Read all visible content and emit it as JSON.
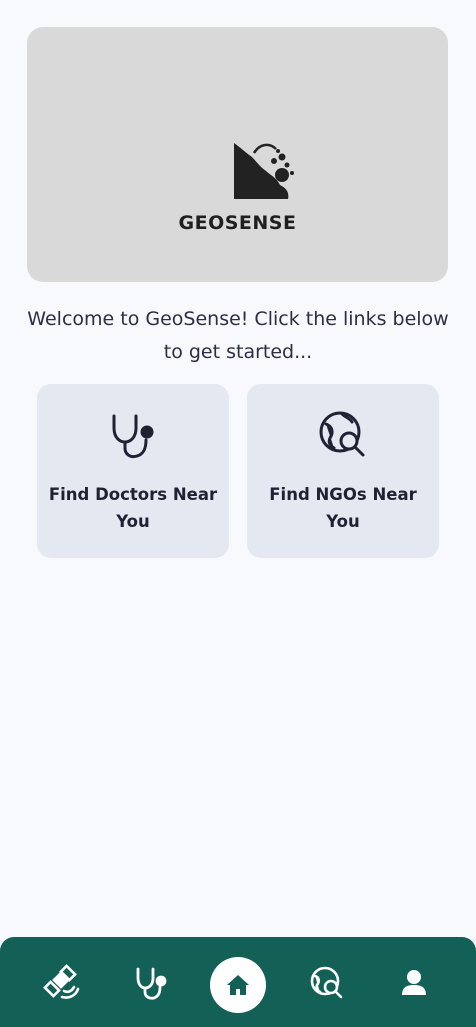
{
  "hero": {
    "brand_name": "GEOSENSE",
    "logo_icon": "landslide-logo-icon"
  },
  "welcome": {
    "message": "Welcome to GeoSense! Click the links below to get started..."
  },
  "cards": [
    {
      "label": "Find Doctors Near You",
      "icon": "stethoscope-icon"
    },
    {
      "label": "Find NGOs Near You",
      "icon": "globe-search-icon"
    }
  ],
  "bottom_nav": {
    "items": [
      {
        "icon": "satellite-icon"
      },
      {
        "icon": "stethoscope-icon"
      },
      {
        "icon": "home-icon",
        "active": true
      },
      {
        "icon": "globe-search-icon"
      },
      {
        "icon": "user-icon"
      }
    ]
  },
  "colors": {
    "nav_background": "#136057",
    "accent": "#136057",
    "card_background": "#e3e8f1",
    "hero_background": "#d9d9d9",
    "page_background": "#f7f9fc"
  }
}
